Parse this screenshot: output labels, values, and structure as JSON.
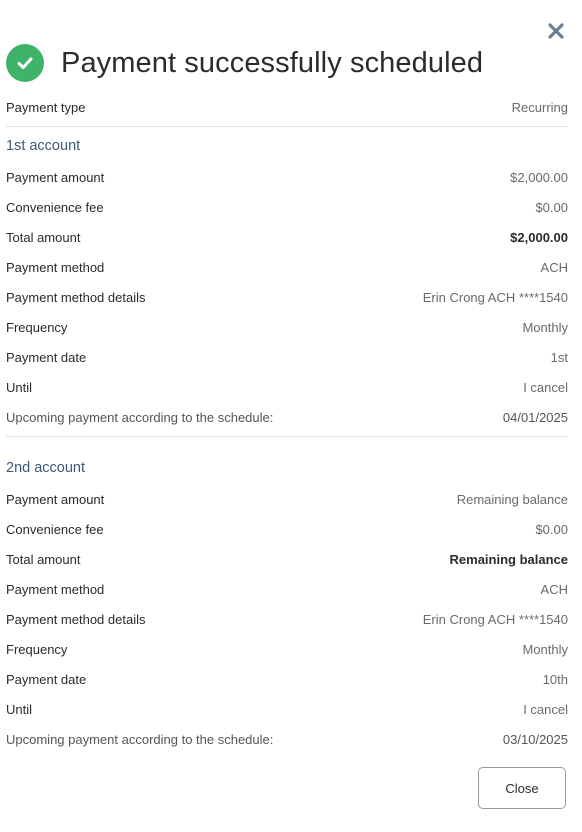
{
  "dialog": {
    "title": "Payment successfully scheduled",
    "payment_type_label": "Payment type",
    "payment_type_value": "Recurring",
    "close_button_label": "Close",
    "success_color": "#3fb36a",
    "accent_color": "#3e5a75"
  },
  "accounts": [
    {
      "title": "1st account",
      "rows": [
        {
          "label": "Payment amount",
          "value": "$2,000.00"
        },
        {
          "label": "Convenience fee",
          "value": "$0.00"
        },
        {
          "label": "Total amount",
          "value": "$2,000.00"
        },
        {
          "label": "Payment method",
          "value": "ACH"
        },
        {
          "label": "Payment method details",
          "value": "Erin Crong ACH ****1540"
        },
        {
          "label": "Frequency",
          "value": "Monthly"
        },
        {
          "label": "Payment date",
          "value": "1st"
        },
        {
          "label": "Until",
          "value": "I cancel"
        },
        {
          "label": "Upcoming payment according to the schedule:",
          "value": "04/01/2025"
        }
      ]
    },
    {
      "title": "2nd account",
      "rows": [
        {
          "label": "Payment amount",
          "value": "Remaining balance"
        },
        {
          "label": "Convenience fee",
          "value": "$0.00"
        },
        {
          "label": "Total amount",
          "value": "Remaining balance"
        },
        {
          "label": "Payment method",
          "value": "ACH"
        },
        {
          "label": "Payment method details",
          "value": "Erin Crong ACH ****1540"
        },
        {
          "label": "Frequency",
          "value": "Monthly"
        },
        {
          "label": "Payment date",
          "value": "10th"
        },
        {
          "label": "Until",
          "value": "I cancel"
        },
        {
          "label": "Upcoming payment according to the schedule:",
          "value": "03/10/2025"
        }
      ]
    }
  ]
}
